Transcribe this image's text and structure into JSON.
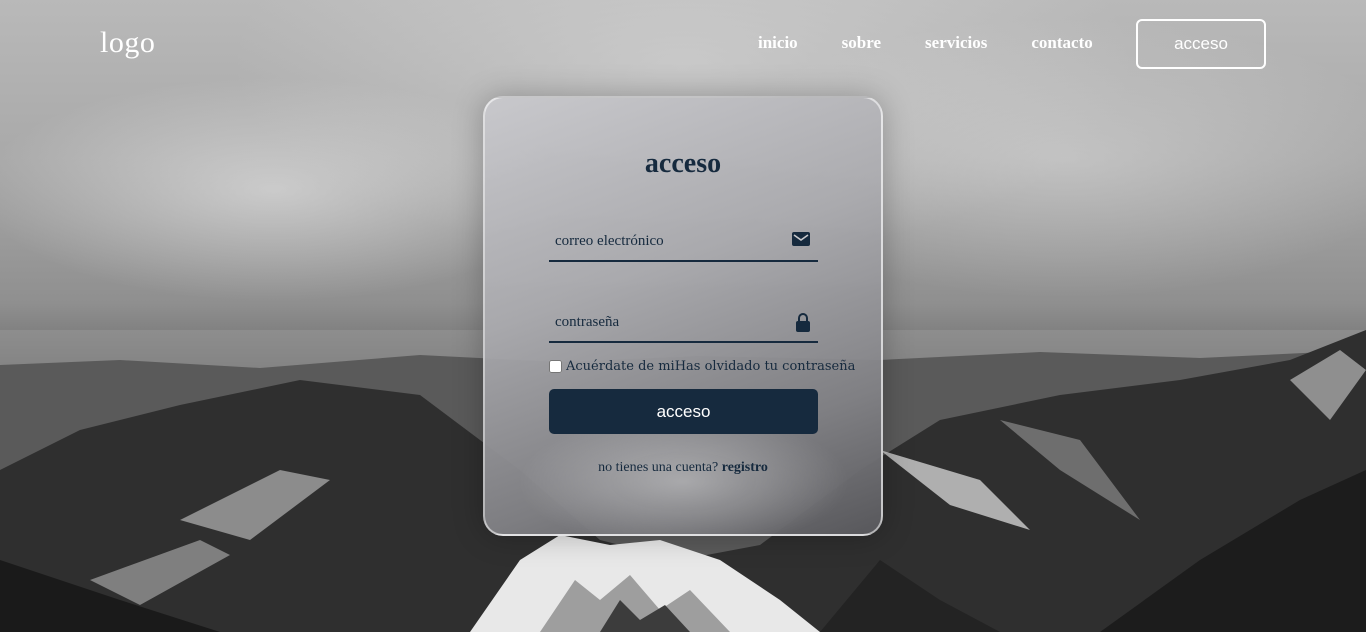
{
  "header": {
    "logo": "logo",
    "nav": [
      "inicio",
      "sobre",
      "servicios",
      "contacto"
    ],
    "login_button": "acceso"
  },
  "login_card": {
    "title": "acceso",
    "email_placeholder": "correo electrónico",
    "email_icon": "envelope-icon",
    "password_placeholder": "contraseña",
    "password_icon": "lock-icon",
    "remember_label": "Acuérdate de mi",
    "forgot_link": "Has olvidado tu contraseña",
    "submit_label": "acceso",
    "register_prompt": "no tienes una cuenta?",
    "register_link": "registro"
  },
  "colors": {
    "accent": "#162a3e",
    "text_light": "#ffffff"
  }
}
